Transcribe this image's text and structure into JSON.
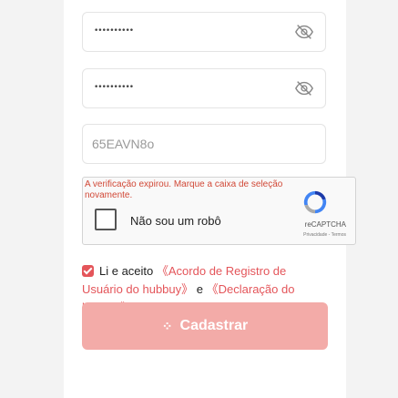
{
  "form": {
    "password_value": "••••••••••",
    "confirm_password_value": "••••••••••",
    "captcha_value": "65EAVN8o"
  },
  "recaptcha": {
    "error": "A verificação expirou. Marque a caixa de seleção novamente.",
    "label": "Não sou um robô",
    "brand": "reCAPTCHA",
    "links": "Privacidade - Termos"
  },
  "terms": {
    "prefix": "Li e aceito",
    "agreement_link": "《Acordo de Registro de Usuário do hubbuy》",
    "conjunction": "e",
    "privacy_link": "《Declaração do hubbuy》"
  },
  "submit": {
    "label": "Cadastrar",
    "spinner_glyph": "⁘"
  },
  "colors": {
    "accent": "#e4555a",
    "button_disabled": "#f3aba8",
    "error": "#d14836"
  },
  "icons": {
    "password_toggle": "eye-off-icon",
    "recaptcha_logo": "recaptcha-logo-icon",
    "checkbox": "checkbox-checked-icon"
  }
}
